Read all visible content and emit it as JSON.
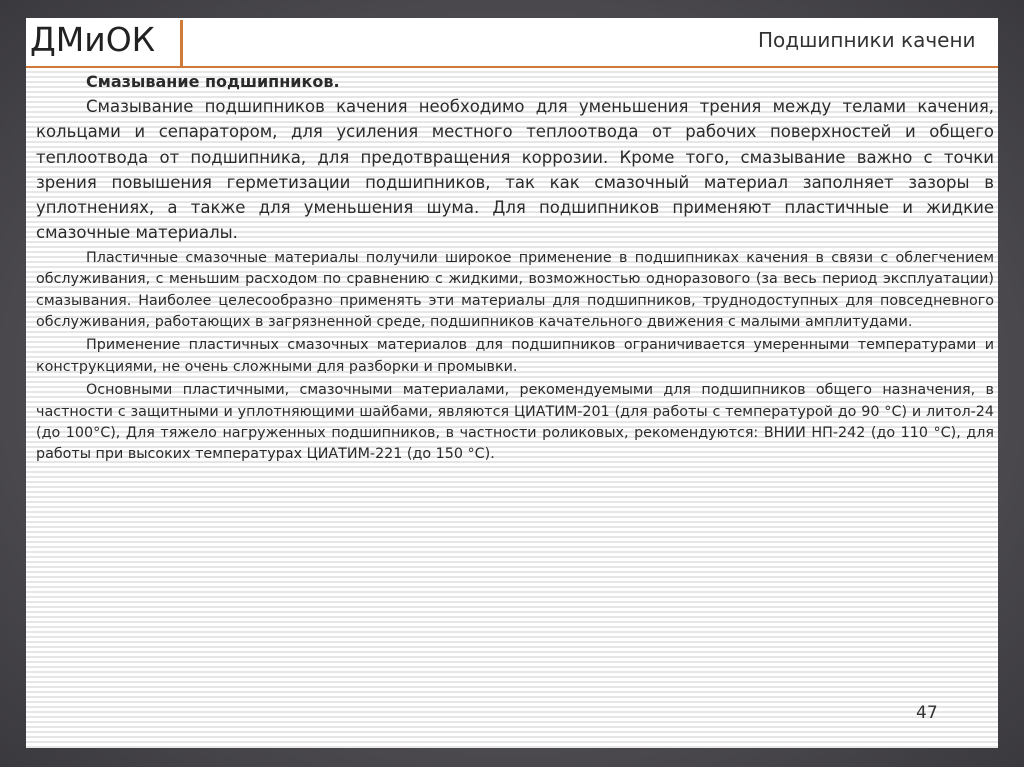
{
  "header": {
    "brand": "ДМиОК",
    "title": "Подшипники качени",
    "accent_color": "#d07a3a"
  },
  "content": {
    "heading": "Смазывание подшипников.",
    "paragraphs": [
      "Смазывание подшипников качения необходимо для уменьшения трения между телами качения, кольцами и сепаратором, для усиления местного теплоотвода от рабочих поверхностей и общего теплоотвода от подшипника, для предотвращения коррозии. Кроме того, смазывание важно с точки зрения повышения герметизации подшипников, так как смазочный материал заполняет зазоры в уплотнениях, а также для уменьшения шума. Для подшипников применяют пластичные и жидкие смазочные материалы.",
      "Пластичные смазочные материалы получили широкое применение в подшипниках качения в связи с облегчением обслуживания, с меньшим расходом по сравнению с жидкими, возможностью одноразового (за весь период эксплуатации) смазывания. Наиболее целесообразно применять эти материалы для подшипников, труднодоступных для повседневного обслуживания, работающих в загрязненной среде, подшипников качательного движения с малыми амплитудами.",
      "Применение пластичных смазочных материалов для подшипников ограничивается умеренными температурами и конструкциями, не очень сложными для разборки и промывки.",
      "Основными пластичными, смазочными материалами, рекомендуемыми для подшипников общего назначения, в частности с защитными и уплотняющими шайбами, являются ЦИАТИМ-201 (для работы с температурой до 90 °C) и литол-24 (до 100°C), Для тяжело нагруженных подшипников, в частности роликовых, рекомендуются: ВНИИ НП-242 (до 110 °C), для работы при высоких температурах ЦИАТИМ-221 (до 150 °C)."
    ]
  },
  "footer": {
    "page_number": "47"
  }
}
